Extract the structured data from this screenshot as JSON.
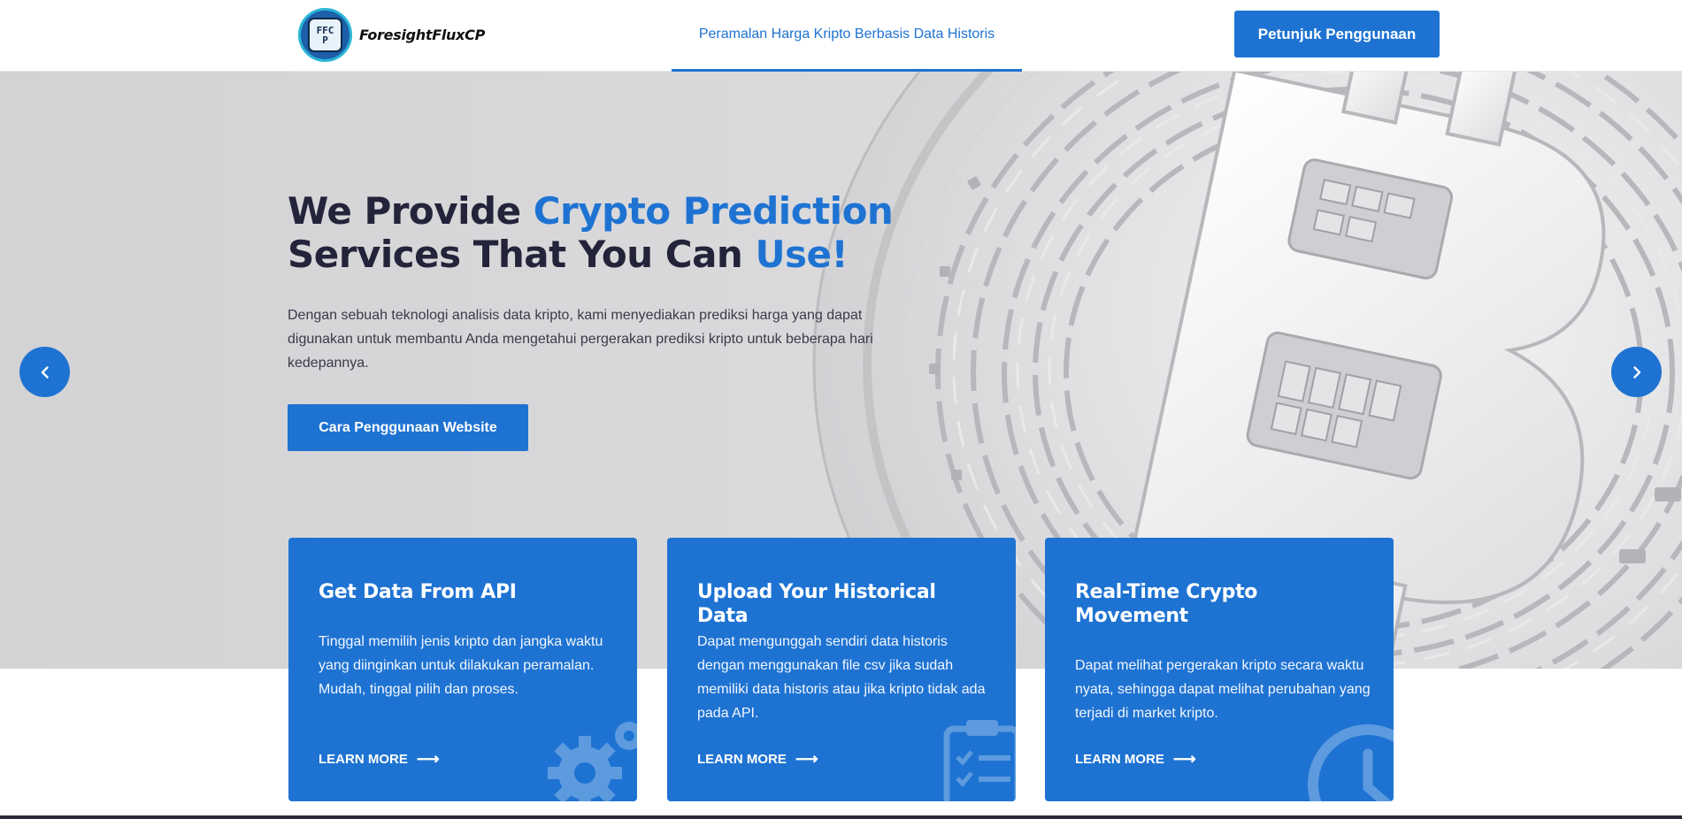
{
  "header": {
    "logo_badge_text": "FFCP",
    "logo_text": "ForesightFluxCP",
    "nav_link": "Peramalan Harga Kripto Berbasis Data Historis",
    "guide_button": "Petunjuk Penggunaan"
  },
  "hero": {
    "title_part1": "We Provide ",
    "title_highlight1": "Crypto Prediction",
    "title_part2": "Services That You Can ",
    "title_highlight2": "Use!",
    "description": "Dengan sebuah teknologi analisis data kripto, kami menyediakan prediksi harga yang dapat digunakan untuk membantu Anda mengetahui pergerakan prediksi kripto untuk beberapa hari kedepannya.",
    "button": "Cara Penggunaan Website",
    "prev_icon": "chevron-left-icon",
    "next_icon": "chevron-right-icon"
  },
  "cards": [
    {
      "title": "Get Data From API",
      "text": "Tinggal memilih jenis kripto dan jangka waktu yang diinginkan untuk dilakukan peramalan. Mudah, tinggal pilih dan proses.",
      "link": "LEARN MORE",
      "icon": "gears-icon"
    },
    {
      "title": "Upload Your Historical Data",
      "text": "Dapat mengunggah sendiri data historis dengan menggunakan file csv jika sudah memiliki data historis atau jika kripto tidak ada pada API.",
      "link": "LEARN MORE",
      "icon": "clipboard-check-icon"
    },
    {
      "title": "Real-Time Crypto Movement",
      "text": "Dapat melihat pergerakan kripto secara waktu nyata, sehingga dapat melihat perubahan yang terjadi di market kripto.",
      "link": "LEARN MORE",
      "icon": "clock-icon"
    }
  ],
  "colors": {
    "accent": "#1e73d2",
    "heading": "#23233a",
    "hero_bg": "#d9d9db"
  }
}
